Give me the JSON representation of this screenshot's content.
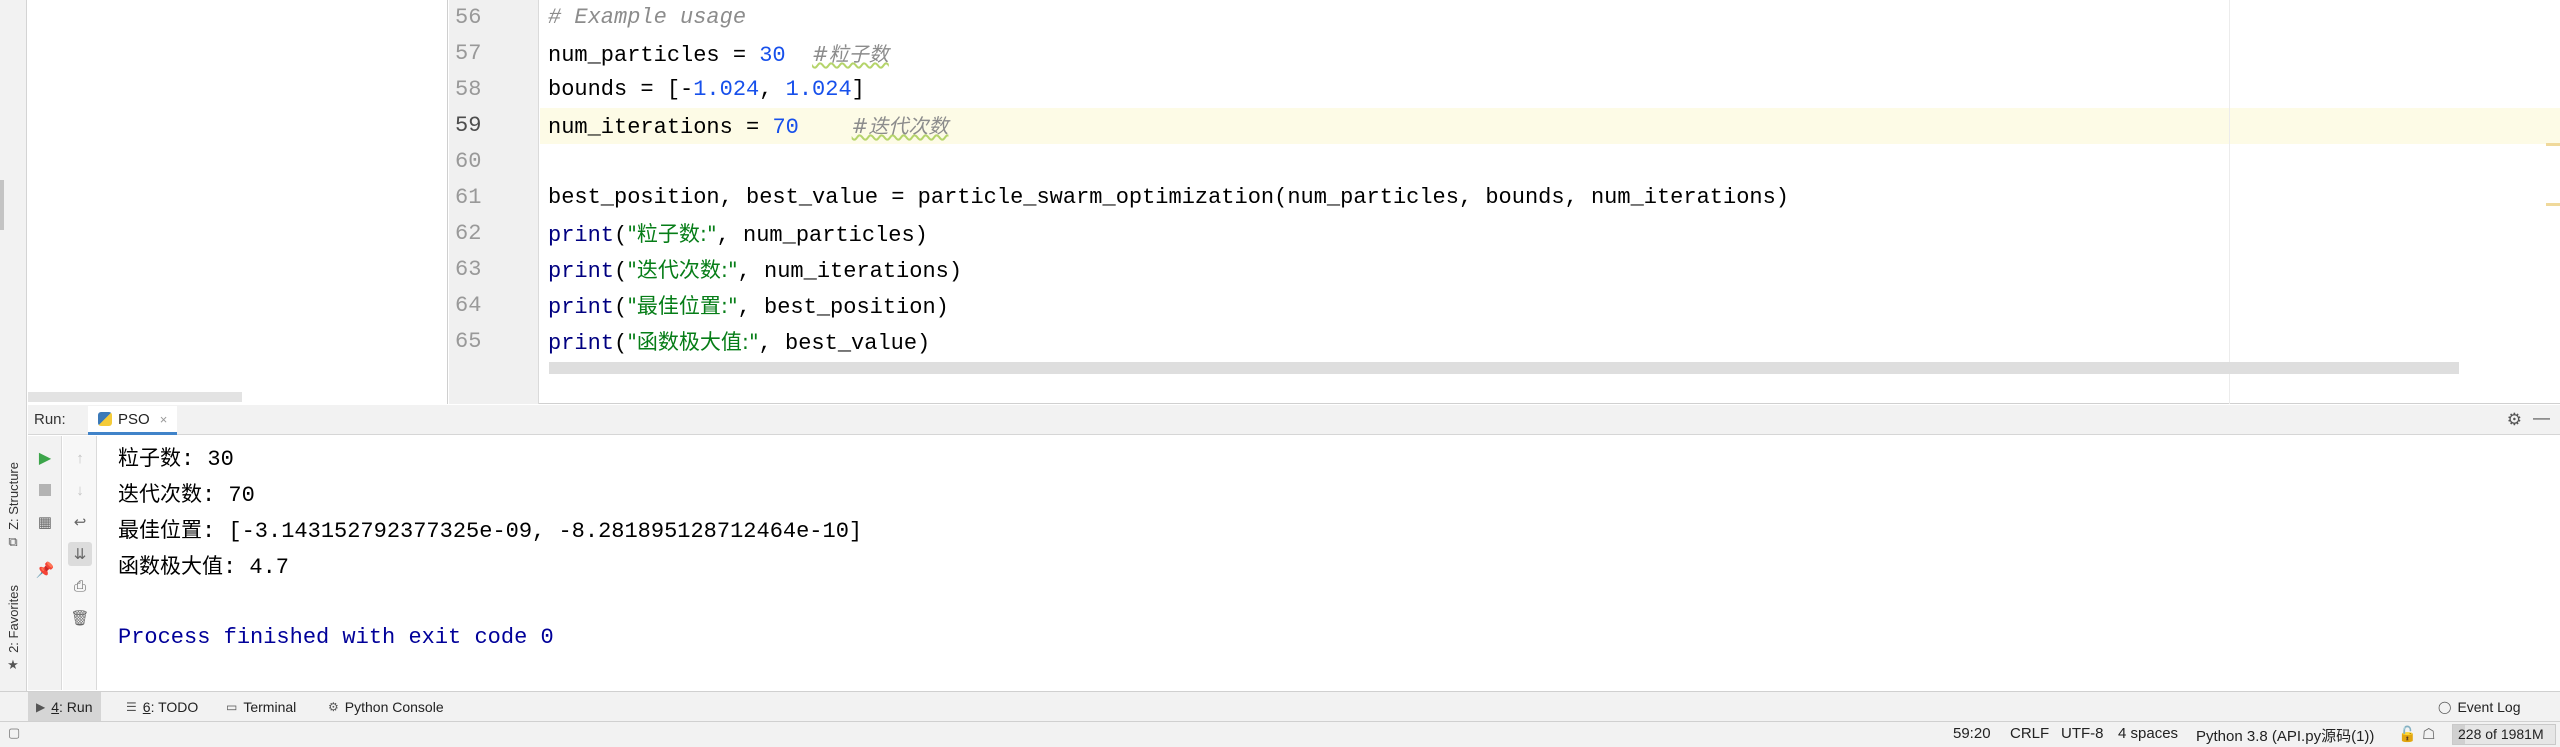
{
  "side_tabs": {
    "structure": "Z: Structure",
    "favorites": "2: Favorites"
  },
  "editor": {
    "lines": [
      {
        "num": "56",
        "tokens": [
          {
            "t": "# Example usage",
            "c": "c-com"
          }
        ]
      },
      {
        "num": "57",
        "tokens": [
          {
            "t": "num_particles = "
          },
          {
            "t": "30",
            "c": "c-num"
          },
          {
            "t": "  "
          },
          {
            "t": "#粒子数",
            "c": "c-cjk"
          }
        ]
      },
      {
        "num": "58",
        "tokens": [
          {
            "t": "bounds = [-"
          },
          {
            "t": "1.024",
            "c": "c-num"
          },
          {
            "t": ", "
          },
          {
            "t": "1.024",
            "c": "c-num"
          },
          {
            "t": "]"
          }
        ]
      },
      {
        "num": "59",
        "current": true,
        "tokens": [
          {
            "t": "num_iterations = "
          },
          {
            "t": "70",
            "c": "c-num"
          },
          {
            "t": "    "
          },
          {
            "t": "#迭代次数",
            "c": "c-cjk"
          }
        ]
      },
      {
        "num": "60",
        "tokens": []
      },
      {
        "num": "61",
        "tokens": [
          {
            "t": "best_position, best_value = particle_swarm_optimization(num_particles, bounds, num_iterations)"
          }
        ]
      },
      {
        "num": "62",
        "tokens": [
          {
            "t": "print",
            "c": "c-bi"
          },
          {
            "t": "("
          },
          {
            "t": "\"粒子数:\"",
            "c": "c-str"
          },
          {
            "t": ", num_particles)"
          }
        ]
      },
      {
        "num": "63",
        "tokens": [
          {
            "t": "print",
            "c": "c-bi"
          },
          {
            "t": "("
          },
          {
            "t": "\"迭代次数:\"",
            "c": "c-str"
          },
          {
            "t": ", num_iterations)"
          }
        ]
      },
      {
        "num": "64",
        "tokens": [
          {
            "t": "print",
            "c": "c-bi"
          },
          {
            "t": "("
          },
          {
            "t": "\"最佳位置:\"",
            "c": "c-str"
          },
          {
            "t": ", best_position)"
          }
        ]
      },
      {
        "num": "65",
        "tokens": [
          {
            "t": "print",
            "c": "c-bi"
          },
          {
            "t": "("
          },
          {
            "t": "\"函数极大值:\"",
            "c": "c-str"
          },
          {
            "t": ", best_value)"
          }
        ]
      }
    ]
  },
  "run_panel": {
    "title": "Run:",
    "tab_label": "PSO",
    "tab_close": "×",
    "settings_icon": "gear-icon",
    "hide_icon": "minimize-icon"
  },
  "console": {
    "lines": [
      {
        "label": "粒子数",
        "value": ": 30"
      },
      {
        "label": "迭代次数",
        "value": ": 70"
      },
      {
        "label": "最佳位置",
        "value": ": [-3.143152792377325e-09, -8.281895128712464e-10]"
      },
      {
        "label": "函数极大值",
        "value": ": 4.7"
      }
    ],
    "exit_message": "Process finished with exit code 0"
  },
  "tool_windows": {
    "run_key": "4",
    "run_label": ": Run",
    "todo_key": "6",
    "todo_label": ": TODO",
    "terminal": "Terminal",
    "python_console": "Python Console",
    "event_log": "Event Log"
  },
  "status_bar": {
    "position": "59:20",
    "line_sep": "CRLF",
    "encoding": "UTF-8",
    "indent": "4 spaces",
    "interpreter": "Python 3.8 (API.py源码(1))",
    "memory": "228 of 1981M",
    "memory_used_fraction": 0.115
  }
}
